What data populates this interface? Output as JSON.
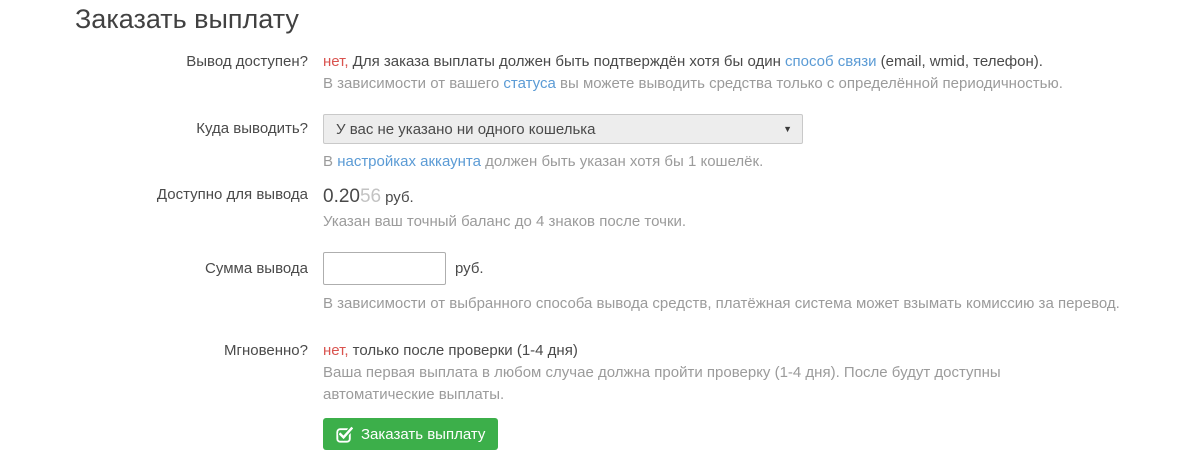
{
  "page": {
    "title": "Заказать выплату"
  },
  "colors": {
    "accent_green": "#3caf4a",
    "link_blue": "#5b9bd5",
    "danger_red": "#d9534f"
  },
  "availability": {
    "label": "Вывод доступен?",
    "status_no": "нет,",
    "text_before_link": " Для заказа выплаты должен быть подтверждён хотя бы один ",
    "link": "способ связи",
    "text_after_link": " (email, wmid, телефон).",
    "help_before_link": "В зависимости от вашего ",
    "help_link": "статуса",
    "help_after_link": " вы можете выводить средства только с определённой периодичностью."
  },
  "destination": {
    "label": "Куда выводить?",
    "select_value": "У вас не указано ни одного кошелька",
    "arrow_glyph": "▼",
    "help_before_link": "В ",
    "help_link": "настройках аккаунта",
    "help_after_link": " должен быть указан хотя бы 1 кошелёк."
  },
  "available": {
    "label": "Доступно для вывода",
    "amount_main": "0.20",
    "amount_faded": "56",
    "currency": "руб.",
    "help": "Указан ваш точный баланс до 4 знаков после точки."
  },
  "amount": {
    "label": "Сумма вывода",
    "input_value": "",
    "currency": "руб.",
    "help": "В зависимости от выбранного способа вывода средств, платёжная система может взымать комиссию за перевод."
  },
  "instant": {
    "label": "Мгновенно?",
    "status_no": "нет,",
    "text": " только после проверки (1-4 дня)",
    "help": "Ваша первая выплата в любом случае должна пройти проверку (1-4 дня). После будут доступны автоматические выплаты."
  },
  "submit": {
    "label": "Заказать выплату",
    "icon": "check-square-icon"
  }
}
